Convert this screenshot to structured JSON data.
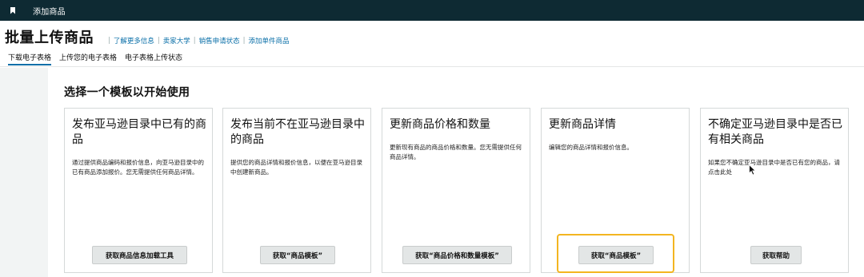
{
  "topbar": {
    "title": "添加商品"
  },
  "header": {
    "title": "批量上传商品",
    "links": [
      "了解更多信息",
      "卖家大学",
      "销售申请状态",
      "添加单件商品"
    ]
  },
  "tabs": [
    "下载电子表格",
    "上传您的电子表格",
    "电子表格上传状态"
  ],
  "section_title": "选择一个模板以开始使用",
  "cards": [
    {
      "title": "发布亚马逊目录中已有的商品",
      "desc": "通过提供商品编码和报价信息，向亚马逊目录中的已有商品添加报价。您无需提供任何商品详情。",
      "button": "获取商品信息加载工具"
    },
    {
      "title": "发布当前不在亚马逊目录中的商品",
      "desc": "提供您的商品详情和报价信息，以便在亚马逊目录中创建新商品。",
      "button": "获取“商品模板”"
    },
    {
      "title": "更新商品价格和数量",
      "desc": "更新现有商品的商品价格和数量。您无需提供任何商品详情。",
      "button": "获取“商品价格和数量模板”"
    },
    {
      "title": "更新商品详情",
      "desc": "编辑您的商品详情和报价信息。",
      "button": "获取“商品模板”"
    },
    {
      "title": "不确定亚马逊目录中是否已有相关商品",
      "desc": "如果您不确定亚马逊目录中是否已有您的商品，请点击此处",
      "button": "获取帮助"
    }
  ],
  "colors": {
    "topbar": "#0e2a33",
    "link": "#0a6fa8",
    "highlight": "#f3b520",
    "button": "#e3e6e6"
  }
}
